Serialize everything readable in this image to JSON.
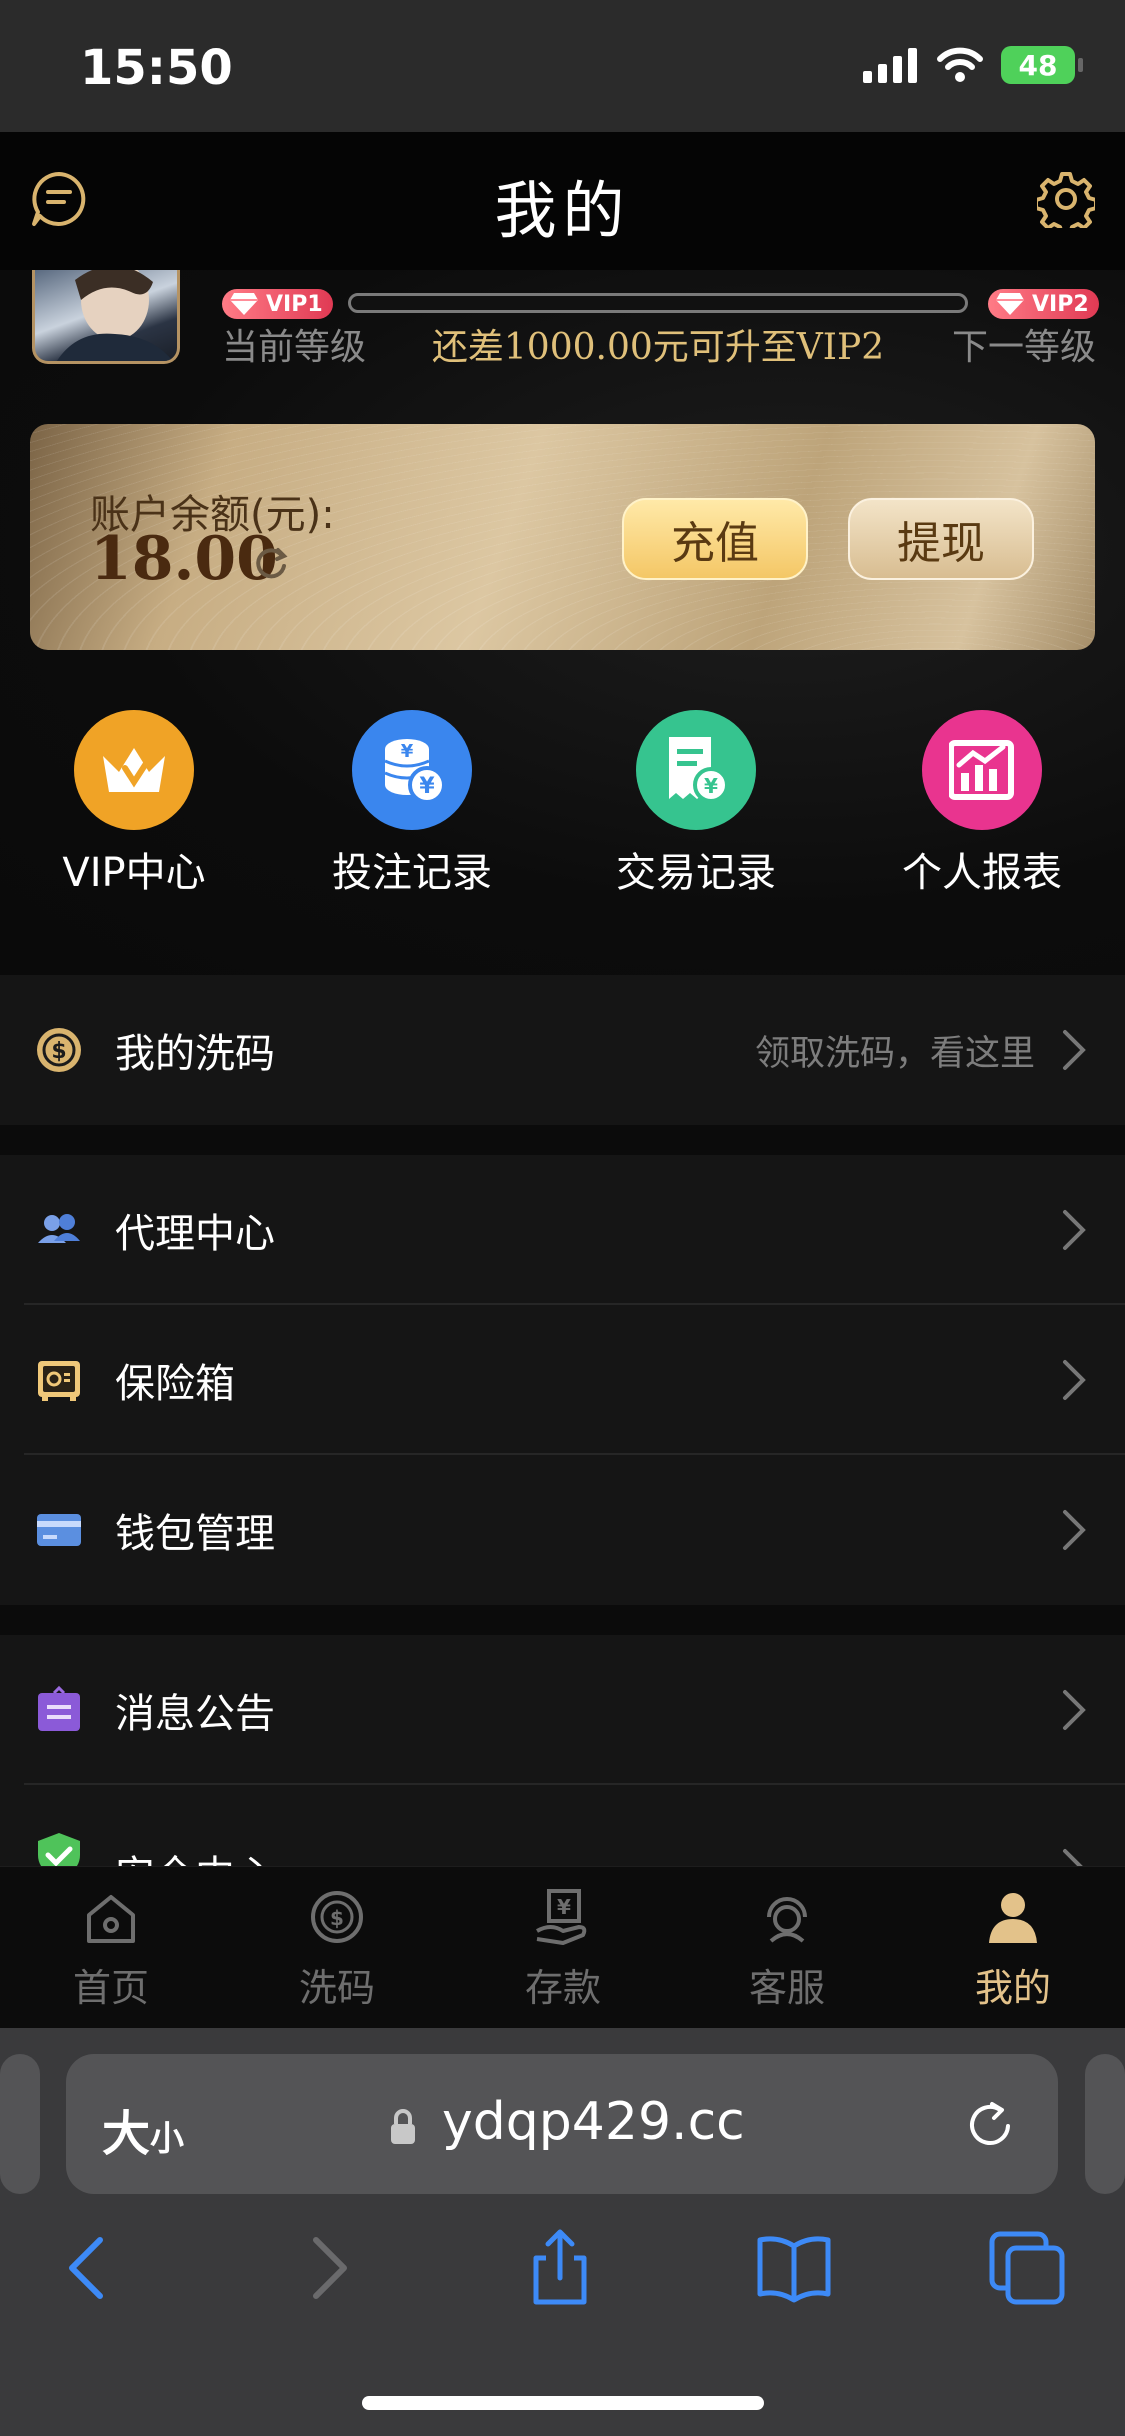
{
  "status_bar": {
    "time": "15:50",
    "battery": "48"
  },
  "header": {
    "title": "我的"
  },
  "vip": {
    "current_badge": "VIP1",
    "next_badge": "VIP2",
    "current_label": "当前等级",
    "next_label": "下一等级",
    "upgrade_text": "还差1000.00元可升至VIP2",
    "progress_fraction": 0
  },
  "balance": {
    "label": "账户余额(元):",
    "amount": "18.00",
    "recharge_label": "充值",
    "withdraw_label": "提现"
  },
  "shortcuts": [
    {
      "label": "VIP中心",
      "icon": "crown-icon",
      "color": "#f0a326"
    },
    {
      "label": "投注记录",
      "icon": "coins-icon",
      "color": "#3a86ee"
    },
    {
      "label": "交易记录",
      "icon": "receipt-icon",
      "color": "#36c48f"
    },
    {
      "label": "个人报表",
      "icon": "chart-icon",
      "color": "#e9348f"
    }
  ],
  "menu": {
    "wash": {
      "title": "我的洗码",
      "hint": "领取洗码，看这里"
    },
    "agent": {
      "title": "代理中心"
    },
    "safe": {
      "title": "保险箱"
    },
    "wallet": {
      "title": "钱包管理"
    },
    "notice": {
      "title": "消息公告"
    },
    "security": {
      "title": "安全中心"
    }
  },
  "tabs": [
    {
      "label": "首页",
      "icon": "home-icon"
    },
    {
      "label": "洗码",
      "icon": "wash-icon"
    },
    {
      "label": "存款",
      "icon": "deposit-icon"
    },
    {
      "label": "客服",
      "icon": "support-icon"
    },
    {
      "label": "我的",
      "icon": "profile-icon",
      "active": true
    }
  ],
  "browser": {
    "text_size_label_big": "大",
    "text_size_label_small": "小",
    "url": "ydqp429.cc"
  },
  "colors": {
    "accent_gold": "#e3c28a",
    "background": "#0b0b0b",
    "row": "#151515"
  }
}
